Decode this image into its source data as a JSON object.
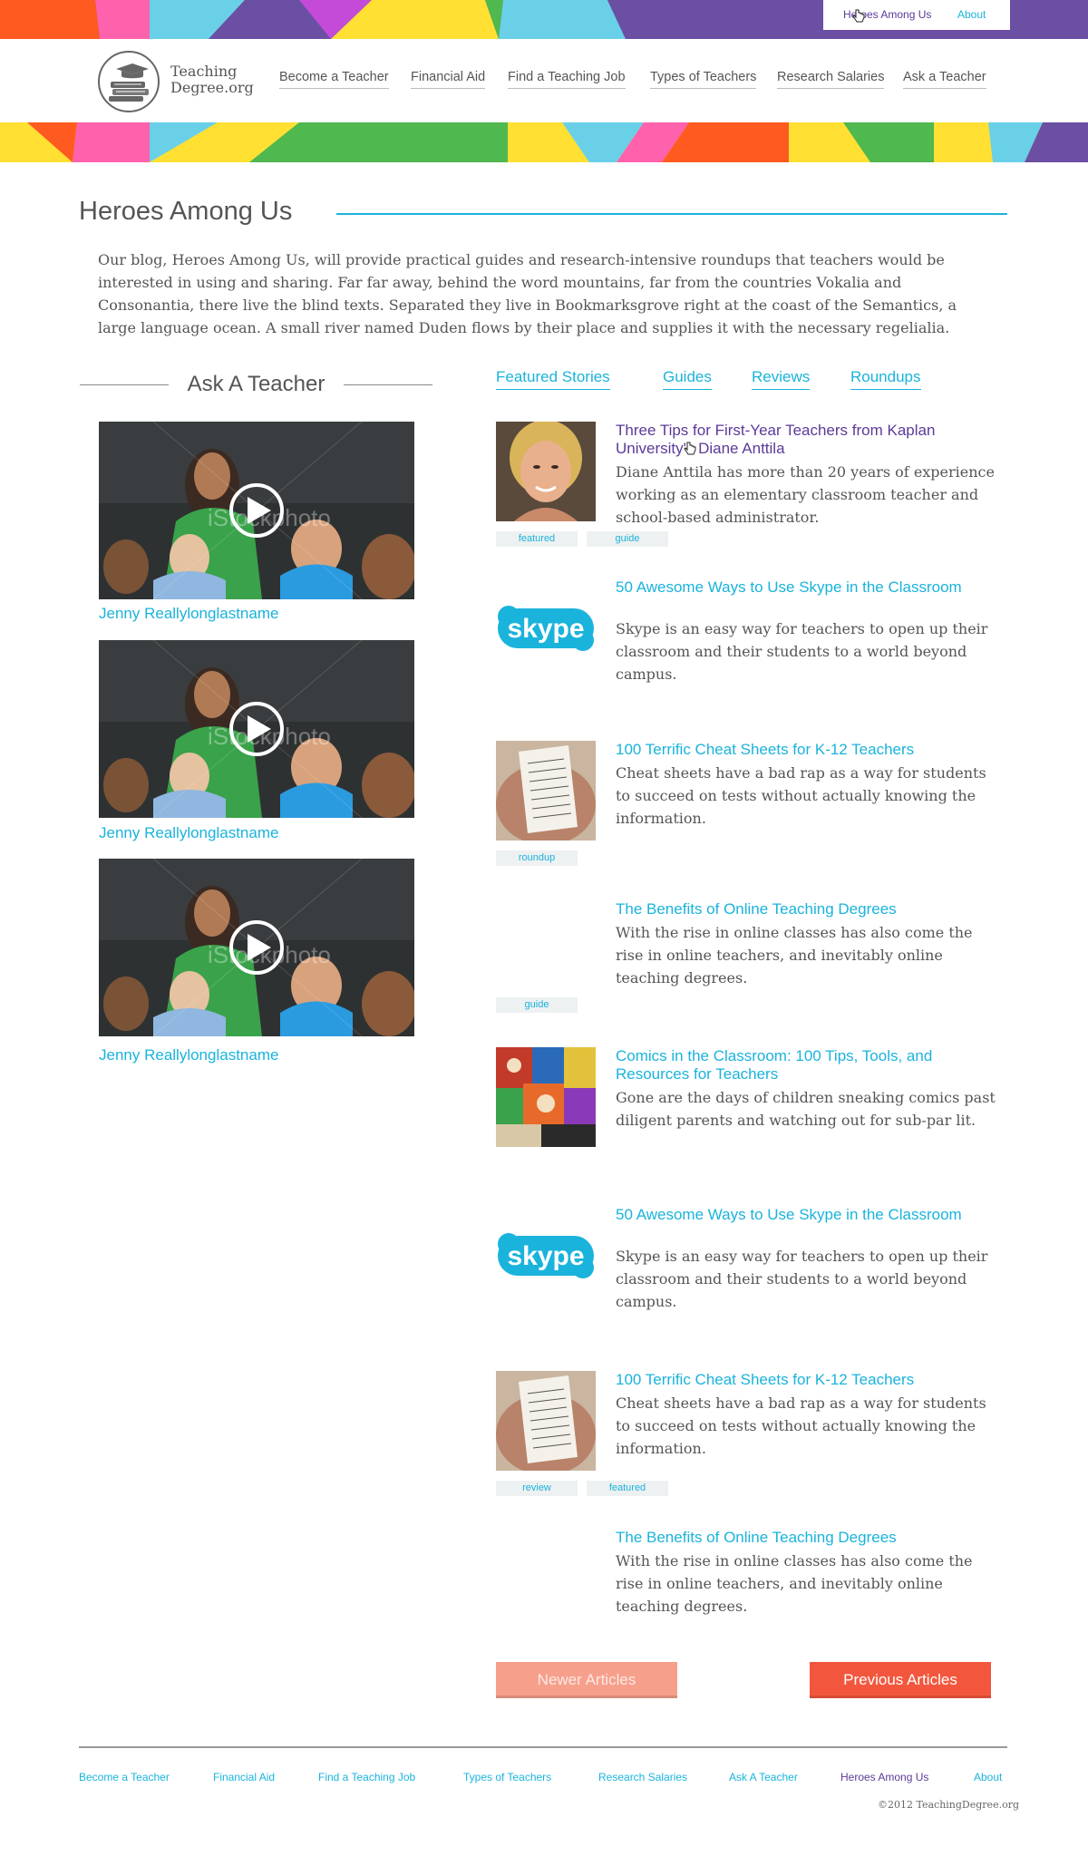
{
  "colors": {
    "accent": "#1ab3dc",
    "visited": "#5b3a99",
    "button_primary": "#f2573d",
    "button_disabled": "#f6a08c"
  },
  "top_links": {
    "heroes": "Heroes Among Us",
    "about": "About"
  },
  "logo": {
    "line1": "Teaching",
    "line2": "Degree.org",
    "icon": "books-graduation-cap-icon"
  },
  "nav": [
    "Become a Teacher",
    "Financial Aid",
    "Find a Teaching Job",
    "Types of Teachers",
    "Research Salaries",
    "Ask a Teacher"
  ],
  "page": {
    "title": "Heroes Among Us",
    "intro": "Our blog, Heroes Among Us, will provide practical guides and research-intensive roundups that teachers would be interested in using and sharing. Far far away, behind the word mountains, far from the countries Vokalia and Consonantia, there live the blind texts. Separated they live in Bookmarksgrove right at the coast of the Semantics, a large language ocean. A small river named Duden flows by their place and supplies it with the necessary regelialia."
  },
  "ask": {
    "title": "Ask A Teacher",
    "videos": [
      {
        "name": "Jenny Reallylonglastname",
        "watermark": "iStockphoto"
      },
      {
        "name": "Jenny Reallylonglastname",
        "watermark": "iStockphoto"
      },
      {
        "name": "Jenny Reallylonglastname",
        "watermark": "iStockphoto"
      }
    ]
  },
  "tabs": [
    "Featured Stories",
    "Guides",
    "Reviews",
    "Roundups"
  ],
  "articles": [
    {
      "title": "Three Tips for First-Year Teachers from Kaplan University's Diane Anttila",
      "desc": "Diane Anttila has more than 20 years of experience working as an elementary classroom teacher and school-based administrator.",
      "thumb": "portrait-photo",
      "tags": [
        "featured",
        "guide"
      ]
    },
    {
      "title": "50 Awesome Ways to Use Skype in the Classroom",
      "desc": "Skype is an easy way for teachers to open up their classroom and their students to a world beyond campus.",
      "thumb": "skype-logo",
      "logo_text": "skype",
      "tags": []
    },
    {
      "title": "100 Terrific Cheat Sheets for K-12 Teachers",
      "desc": "Cheat sheets have a bad rap as a way for students to succeed on tests without actually knowing the information.",
      "thumb": "cheat-sheet-photo",
      "tags": [
        "roundup"
      ]
    },
    {
      "title": "The Benefits of Online Teaching Degrees",
      "desc": "With the rise in online classes has also come the rise in online teachers, and inevitably online teaching degrees.",
      "thumb": "",
      "tags": [
        "guide"
      ]
    },
    {
      "title": "Comics in the Classroom: 100 Tips, Tools, and Resources for Teachers",
      "desc": "Gone are the days of children sneaking comics past diligent parents and watching out for sub-par lit.",
      "thumb": "comics-photo",
      "tags": []
    },
    {
      "title": "50 Awesome Ways to Use Skype in the Classroom",
      "desc": "Skype is an easy way for teachers to open up their classroom and their students to a world beyond campus.",
      "thumb": "skype-logo",
      "logo_text": "skype",
      "tags": []
    },
    {
      "title": "100 Terrific Cheat Sheets for K-12 Teachers",
      "desc": "Cheat sheets have a bad rap as a way for students to succeed on tests without actually knowing the information.",
      "thumb": "cheat-sheet-photo",
      "tags": [
        "review",
        "featured"
      ]
    },
    {
      "title": "The Benefits of Online Teaching Degrees",
      "desc": "With the rise in online classes has also come the rise in online teachers, and inevitably online teaching degrees.",
      "thumb": "",
      "tags": []
    }
  ],
  "pagination": {
    "newer": "Newer Articles",
    "previous": "Previous Articles"
  },
  "footer": {
    "links": [
      "Become a Teacher",
      "Financial Aid",
      "Find a Teaching Job",
      "Types of Teachers",
      "Research Salaries",
      "Ask A Teacher",
      "Heroes Among Us",
      "About"
    ],
    "active": "Heroes Among Us",
    "copyright": "©2012 TeachingDegree.org"
  }
}
